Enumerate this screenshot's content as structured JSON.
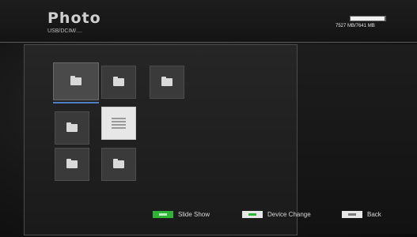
{
  "header": {
    "title": "Photo",
    "path": "USB/DCIM/....",
    "storage_text": "7527 MB/7641 MB",
    "storage_used_fraction": 0.985
  },
  "items": [
    {
      "kind": "folder",
      "label": "",
      "selected": true
    },
    {
      "kind": "folder",
      "label": ""
    },
    {
      "kind": "folder",
      "label": ""
    },
    {
      "kind": "folder",
      "label": ""
    },
    {
      "kind": "file",
      "label": ""
    },
    {
      "kind": "folder",
      "label": ""
    },
    {
      "kind": "folder",
      "label": ""
    }
  ],
  "footer": {
    "slide_show": "Slide Show",
    "device_change": "Device Change",
    "back": "Back"
  },
  "colors": {
    "green_key": "#2fb336",
    "white_key": "#e6e6e6",
    "selection": "#4f7ec4"
  }
}
